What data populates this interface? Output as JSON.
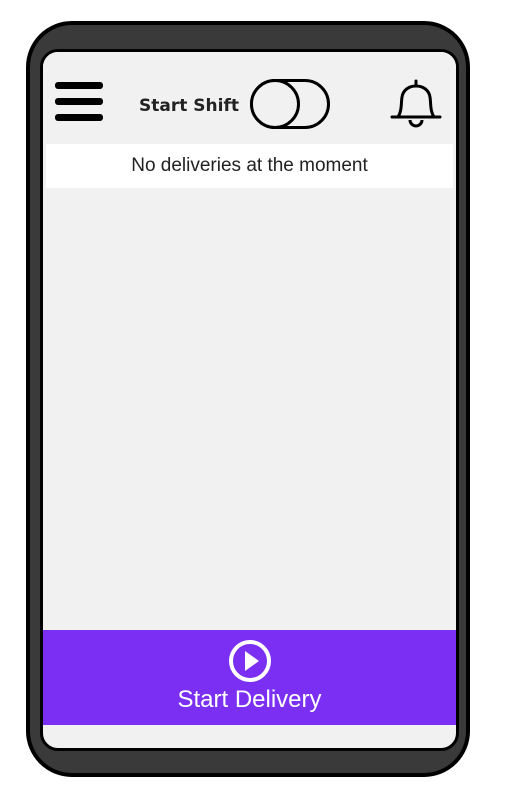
{
  "header": {
    "shift_label": "Start Shift",
    "shift_toggle_on": false,
    "menu_icon": "hamburger-menu-icon",
    "notification_icon": "bell-icon"
  },
  "main": {
    "status_message": "No deliveries at the moment"
  },
  "footer": {
    "cta_label": "Start Delivery",
    "cta_icon": "play-icon"
  },
  "colors": {
    "accent": "#7b2ff2",
    "screen_bg": "#f1f1f1",
    "frame": "#3a3a3a"
  }
}
